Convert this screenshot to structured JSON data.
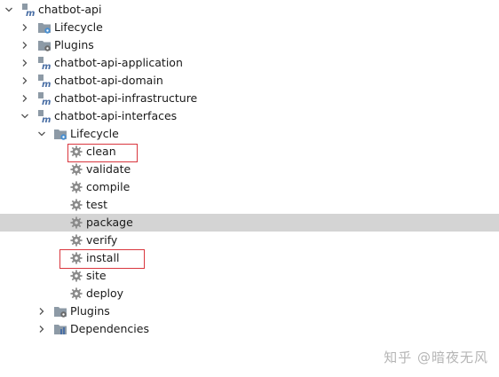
{
  "tree": {
    "root": "chatbot-api",
    "root_lifecycle": "Lifecycle",
    "root_plugins": "Plugins",
    "modules": [
      "chatbot-api-application",
      "chatbot-api-domain",
      "chatbot-api-infrastructure",
      "chatbot-api-interfaces"
    ],
    "interfaces_lifecycle": "Lifecycle",
    "goals": [
      "clean",
      "validate",
      "compile",
      "test",
      "package",
      "verify",
      "install",
      "site",
      "deploy"
    ],
    "interfaces_plugins": "Plugins",
    "interfaces_dependencies": "Dependencies"
  },
  "watermark": "知乎 @暗夜无风",
  "colors": {
    "selection": "#d4d4d4",
    "highlight_box": "#d9363e",
    "folder_icon": "#8d9aa6",
    "maven_m": "#4a6fa5",
    "gear": "#8a8a8a"
  }
}
